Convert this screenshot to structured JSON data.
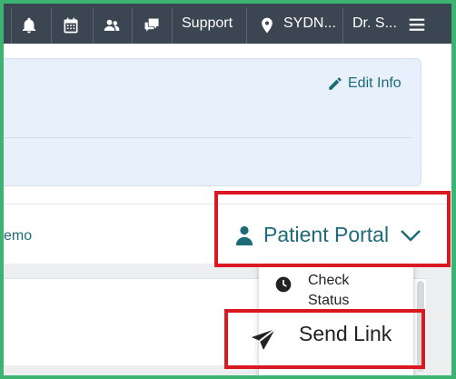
{
  "nav": {
    "support_label": "Support",
    "location_label": "SYDN...",
    "user_label": "Dr. S...",
    "icons": [
      "bell-icon",
      "calendar-icon",
      "people-icon",
      "chat-icon",
      "location-pin-icon",
      "hamburger-menu-icon"
    ]
  },
  "info": {
    "edit_label": "Edit Info"
  },
  "portal_bar": {
    "memo_label": "emo",
    "portal_label": "Patient Portal"
  },
  "portal_menu": {
    "items": [
      {
        "label": "Check Status",
        "icon": "clock-icon"
      },
      {
        "label": "Send Link",
        "icon": "paper-plane-icon"
      }
    ]
  },
  "colors": {
    "accent": "#1d6a78",
    "nav_bg": "#3b4652",
    "panel_bg": "#e7f0fb",
    "highlight": "#d9181f",
    "outer_border": "#3cb371"
  }
}
